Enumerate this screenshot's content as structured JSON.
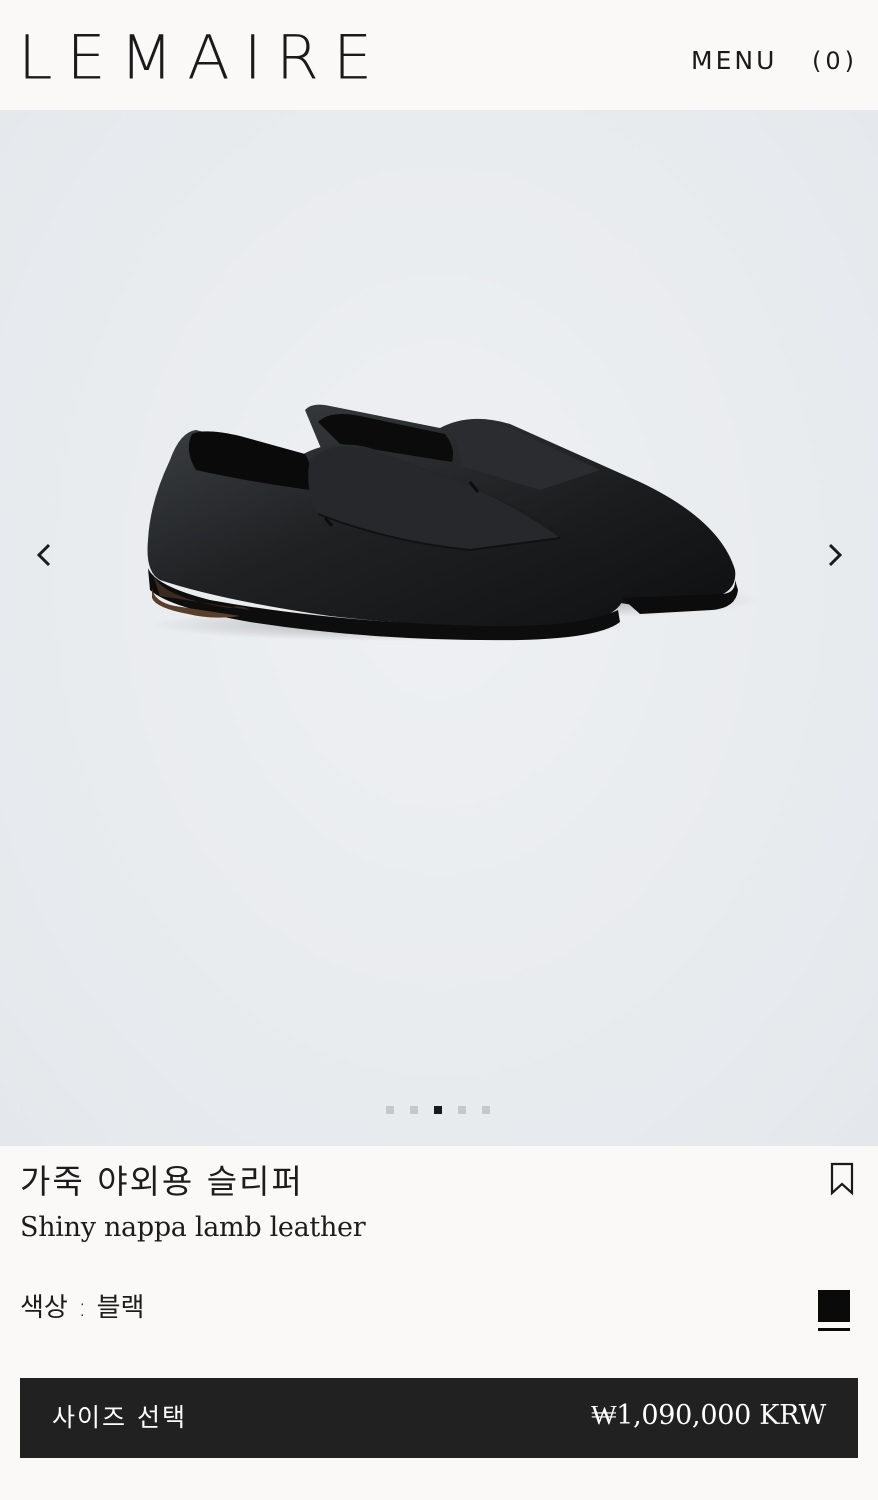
{
  "header": {
    "logo": "LEMAIRE",
    "menu_label": "MENU",
    "cart_label": "(0)"
  },
  "gallery": {
    "prev_icon": "chevron-left-icon",
    "next_icon": "chevron-right-icon",
    "image_count": 5,
    "active_index": 2
  },
  "product": {
    "name_ko": "가죽 야외용 슬리퍼",
    "material": "Shiny nappa lamb leather",
    "color_label": "색상",
    "color_separator": ":",
    "color_value": "블랙",
    "swatch_color": "#0a0a0a"
  },
  "cta": {
    "size_label": "사이즈 선택",
    "price": "₩1,090,000 KRW"
  },
  "colors": {
    "background": "#faf9f7",
    "hero_bg": "#e9ecef",
    "cta_bg": "#212121",
    "text": "#1d1d1d"
  }
}
